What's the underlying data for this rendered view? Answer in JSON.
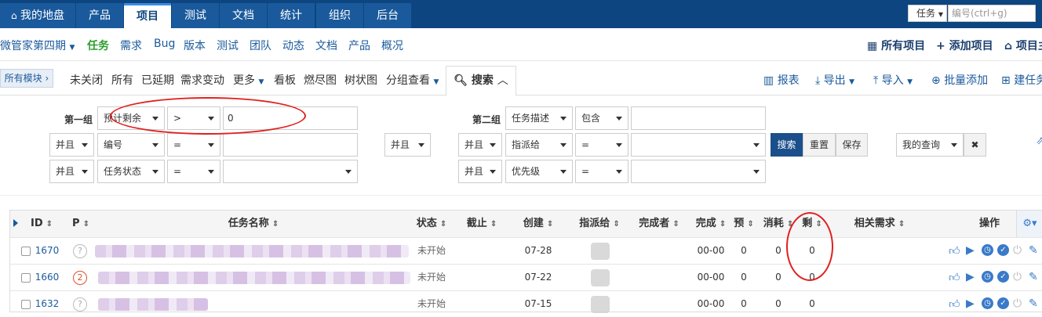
{
  "topnav": {
    "tabs": [
      {
        "label": "我的地盘",
        "active": false
      },
      {
        "label": "产品",
        "active": false
      },
      {
        "label": "项目",
        "active": true
      },
      {
        "label": "测试",
        "active": false
      },
      {
        "label": "文档",
        "active": false
      },
      {
        "label": "统计",
        "active": false
      },
      {
        "label": "组织",
        "active": false
      },
      {
        "label": "后台",
        "active": false
      }
    ],
    "search_type": "任务",
    "search_placeholder": "编号(ctrl+g)"
  },
  "subnav": {
    "project_name": "微管家第四期",
    "items": [
      "任务",
      "需求",
      "Bug",
      "版本",
      "测试",
      "团队",
      "动态",
      "文档",
      "产品",
      "概况"
    ],
    "active_item": "任务",
    "all_projects": "所有项目",
    "add_project": "添加项目",
    "project_home": "项目主"
  },
  "filterbar": {
    "module": "所有模块",
    "filters": [
      "未关闭",
      "所有",
      "已延期",
      "需求变动",
      "更多",
      "看板",
      "燃尽图",
      "树状图",
      "分组查看"
    ],
    "search_label": "搜索",
    "report": "报表",
    "export": "导出",
    "import": "导入",
    "batch_add": "批量添加",
    "create": "建任务"
  },
  "search": {
    "group1_label": "第一组",
    "group2_label": "第二组",
    "g1_rows": [
      {
        "logic": "",
        "field": "预计剩余",
        "op": ">",
        "value": "0"
      },
      {
        "logic": "并且",
        "field": "编号",
        "op": "=",
        "value": ""
      },
      {
        "logic": "并且",
        "field": "任务状态",
        "op": "=",
        "value": ""
      }
    ],
    "group_logic": "并且",
    "g2_rows": [
      {
        "logic": "",
        "field": "任务描述",
        "op": "包含",
        "value": ""
      },
      {
        "logic": "并且",
        "field": "指派给",
        "op": "=",
        "value": ""
      },
      {
        "logic": "并且",
        "field": "优先级",
        "op": "=",
        "value": ""
      }
    ],
    "btn_search": "搜索",
    "btn_reset": "重置",
    "btn_save": "保存",
    "my_query": "我的查询"
  },
  "table": {
    "headers": {
      "id": "ID",
      "p": "P",
      "name": "任务名称",
      "status": "状态",
      "deadline": "截止",
      "created": "创建",
      "assigned": "指派给",
      "finisher": "完成者",
      "finished": "完成",
      "estimate": "预",
      "consumed": "消耗",
      "left": "剩",
      "story": "相关需求",
      "actions": "操作"
    },
    "rows": [
      {
        "id": "1670",
        "pri": "?",
        "status": "未开始",
        "created": "07-28",
        "finished": "00-00",
        "estimate": "0",
        "consumed": "0",
        "left": "0"
      },
      {
        "id": "1660",
        "pri": "2",
        "status": "未开始",
        "created": "07-22",
        "finished": "00-00",
        "estimate": "0",
        "consumed": "0",
        "left": "0"
      },
      {
        "id": "1632",
        "pri": "?",
        "status": "未开始",
        "created": "07-15",
        "finished": "00-00",
        "estimate": "0",
        "consumed": "0",
        "left": "0"
      }
    ]
  },
  "colors": {
    "topbar": "#0d4580",
    "active_green": "#2e9d2e",
    "link_blue": "#1a5a9c",
    "action_blue": "#2e7dd6",
    "annotation_red": "#e02020"
  }
}
